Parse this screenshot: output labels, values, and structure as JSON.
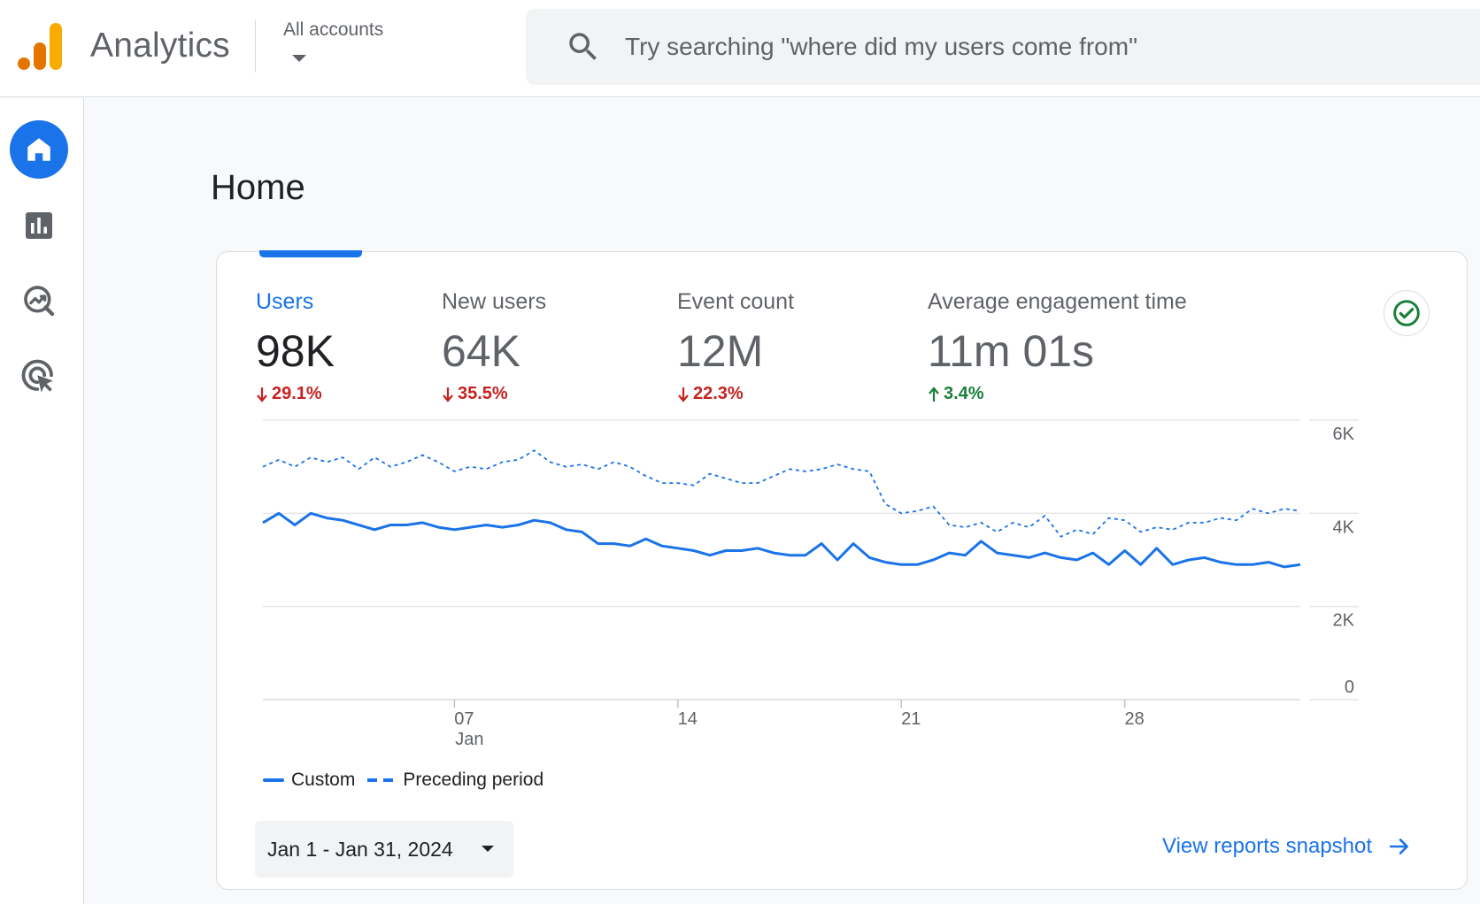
{
  "header": {
    "app_title": "Analytics",
    "accounts_label": "All accounts",
    "search_placeholder": "Try searching \"where did my users come from\""
  },
  "sidebar": {
    "items": [
      {
        "name": "home",
        "icon": "home-icon",
        "active": true
      },
      {
        "name": "reports",
        "icon": "bar-chart-icon",
        "active": false
      },
      {
        "name": "explore",
        "icon": "explore-trend-icon",
        "active": false
      },
      {
        "name": "advertising",
        "icon": "target-cursor-icon",
        "active": false
      }
    ]
  },
  "page": {
    "title": "Home"
  },
  "metrics": [
    {
      "label": "Users",
      "value": "98K",
      "change": "29.1%",
      "direction": "down",
      "selected": true
    },
    {
      "label": "New users",
      "value": "64K",
      "change": "35.5%",
      "direction": "down",
      "selected": false
    },
    {
      "label": "Event count",
      "value": "12M",
      "change": "22.3%",
      "direction": "down",
      "selected": false
    },
    {
      "label": "Average engagement time",
      "value": "11m 01s",
      "change": "3.4%",
      "direction": "up",
      "selected": false
    }
  ],
  "colors": {
    "accent": "#1a73e8",
    "negative": "#c5221f",
    "positive": "#188038",
    "status_ok": "#188038"
  },
  "chart_data": {
    "type": "line",
    "x_ticks": [
      {
        "day": 7,
        "label": "07",
        "sublabel": "Jan"
      },
      {
        "day": 14,
        "label": "14",
        "sublabel": ""
      },
      {
        "day": 21,
        "label": "21",
        "sublabel": ""
      },
      {
        "day": 28,
        "label": "28",
        "sublabel": ""
      }
    ],
    "y_ticks": [
      {
        "value": 6000,
        "label": "6K"
      },
      {
        "value": 4000,
        "label": "4K"
      },
      {
        "value": 2000,
        "label": "2K"
      },
      {
        "value": 0,
        "label": "0"
      }
    ],
    "ylim": [
      0,
      6000
    ],
    "xlim": [
      1,
      31
    ],
    "grid": true,
    "legend_position": "bottom-left",
    "series": [
      {
        "name": "Custom",
        "style": "solid",
        "points": [
          [
            1,
            3800
          ],
          [
            1.5,
            4000
          ],
          [
            2,
            3750
          ],
          [
            2.5,
            4000
          ],
          [
            3,
            3900
          ],
          [
            3.5,
            3850
          ],
          [
            4,
            3750
          ],
          [
            4.5,
            3650
          ],
          [
            5,
            3750
          ],
          [
            5.5,
            3750
          ],
          [
            6,
            3800
          ],
          [
            6.5,
            3700
          ],
          [
            7,
            3650
          ],
          [
            7.5,
            3700
          ],
          [
            8,
            3750
          ],
          [
            8.5,
            3700
          ],
          [
            9,
            3750
          ],
          [
            9.5,
            3850
          ],
          [
            10,
            3800
          ],
          [
            10.5,
            3650
          ],
          [
            11,
            3600
          ],
          [
            11.5,
            3350
          ],
          [
            12,
            3350
          ],
          [
            12.5,
            3300
          ],
          [
            13,
            3450
          ],
          [
            13.5,
            3300
          ],
          [
            14,
            3250
          ],
          [
            14.5,
            3200
          ],
          [
            15,
            3100
          ],
          [
            15.5,
            3200
          ],
          [
            16,
            3200
          ],
          [
            16.5,
            3250
          ],
          [
            17,
            3150
          ],
          [
            17.5,
            3100
          ],
          [
            18,
            3100
          ],
          [
            18.5,
            3350
          ],
          [
            19,
            3000
          ],
          [
            19.5,
            3350
          ],
          [
            20,
            3050
          ],
          [
            20.5,
            2950
          ],
          [
            21,
            2900
          ],
          [
            21.5,
            2900
          ],
          [
            22,
            3000
          ],
          [
            22.5,
            3150
          ],
          [
            23,
            3100
          ],
          [
            23.5,
            3400
          ],
          [
            24,
            3150
          ],
          [
            24.5,
            3100
          ],
          [
            25,
            3050
          ],
          [
            25.5,
            3150
          ],
          [
            26,
            3050
          ],
          [
            26.5,
            3000
          ],
          [
            27,
            3150
          ],
          [
            27.5,
            2900
          ],
          [
            28,
            3200
          ],
          [
            28.5,
            2900
          ],
          [
            29,
            3250
          ],
          [
            29.5,
            2900
          ],
          [
            30,
            3000
          ],
          [
            30.5,
            3050
          ],
          [
            31,
            2950
          ],
          [
            31.5,
            2900
          ],
          [
            32,
            2900
          ],
          [
            32.5,
            2950
          ],
          [
            33,
            2850
          ],
          [
            33.5,
            2900
          ]
        ]
      },
      {
        "name": "Preceding period",
        "style": "dashed",
        "points": [
          [
            1,
            5000
          ],
          [
            1.5,
            5150
          ],
          [
            2,
            5000
          ],
          [
            2.5,
            5200
          ],
          [
            3,
            5100
          ],
          [
            3.5,
            5200
          ],
          [
            4,
            4950
          ],
          [
            4.5,
            5200
          ],
          [
            5,
            5000
          ],
          [
            5.5,
            5100
          ],
          [
            6,
            5250
          ],
          [
            6.5,
            5100
          ],
          [
            7,
            4900
          ],
          [
            7.5,
            5000
          ],
          [
            8,
            4950
          ],
          [
            8.5,
            5100
          ],
          [
            9,
            5150
          ],
          [
            9.5,
            5350
          ],
          [
            10,
            5100
          ],
          [
            10.5,
            5000
          ],
          [
            11,
            5050
          ],
          [
            11.5,
            4950
          ],
          [
            12,
            5100
          ],
          [
            12.5,
            5000
          ],
          [
            13,
            4800
          ],
          [
            13.5,
            4650
          ],
          [
            14,
            4650
          ],
          [
            14.5,
            4600
          ],
          [
            15,
            4850
          ],
          [
            15.5,
            4750
          ],
          [
            16,
            4650
          ],
          [
            16.5,
            4650
          ],
          [
            17,
            4800
          ],
          [
            17.5,
            4950
          ],
          [
            18,
            4900
          ],
          [
            18.5,
            4950
          ],
          [
            19,
            5050
          ],
          [
            19.5,
            4950
          ],
          [
            20,
            4900
          ],
          [
            20.5,
            4200
          ],
          [
            21,
            4000
          ],
          [
            21.5,
            4050
          ],
          [
            22,
            4150
          ],
          [
            22.5,
            3750
          ],
          [
            23,
            3700
          ],
          [
            23.5,
            3800
          ],
          [
            24,
            3600
          ],
          [
            24.5,
            3800
          ],
          [
            25,
            3700
          ],
          [
            25.5,
            3950
          ],
          [
            26,
            3500
          ],
          [
            26.5,
            3650
          ],
          [
            27,
            3550
          ],
          [
            27.5,
            3900
          ],
          [
            28,
            3850
          ],
          [
            28.5,
            3600
          ],
          [
            29,
            3700
          ],
          [
            29.5,
            3650
          ],
          [
            30,
            3800
          ],
          [
            30.5,
            3800
          ],
          [
            31,
            3900
          ],
          [
            31.5,
            3850
          ],
          [
            32,
            4100
          ],
          [
            32.5,
            4000
          ],
          [
            33,
            4100
          ],
          [
            33.5,
            4050
          ]
        ]
      }
    ]
  },
  "date_range": {
    "label": "Jan 1 - Jan 31, 2024"
  },
  "links": {
    "snapshot": "View reports snapshot"
  }
}
